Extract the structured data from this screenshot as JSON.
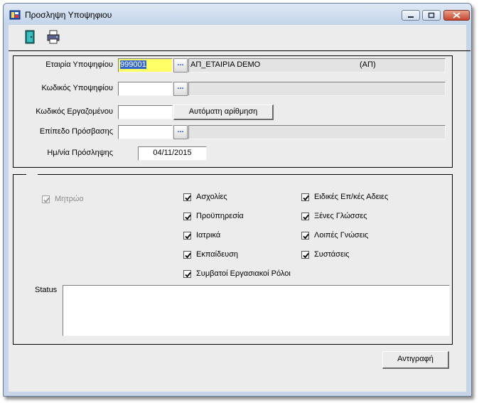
{
  "window": {
    "title": "Προσληψη Υποψηφιου",
    "controls": [
      "minimize-icon",
      "maximize-icon",
      "close-icon"
    ]
  },
  "toolbar": {
    "buttons": [
      {
        "name": "exit-door-icon"
      },
      {
        "name": "printer-icon"
      }
    ]
  },
  "form": {
    "company": {
      "label": "Εταιρία Υποψηφίου",
      "value": "999001",
      "lookup": "...",
      "description": "ΑΠ_ΕΤΑΙΡΙΑ DEMO",
      "code_suffix": "(ΑΠ)"
    },
    "candidate_code": {
      "label": "Κωδικός Υποψηφίου",
      "value": "",
      "lookup": "...",
      "description": ""
    },
    "employee_code": {
      "label": "Κωδικός Εργαζομένου",
      "value": "",
      "auto_button": "Αυτόματη αρίθμηση"
    },
    "access_level": {
      "label": "Επίπεδο Πρόσβασης",
      "value": "",
      "lookup": "...",
      "description": ""
    },
    "hire_date": {
      "label": "Ημ/νία Πρόσληψης",
      "value": "04/11/2015"
    }
  },
  "options": {
    "registry": {
      "label": "Μητρώο",
      "checked": true,
      "disabled": true
    },
    "column1": [
      {
        "label": "Ασχολίες",
        "checked": true
      },
      {
        "label": "Προϋπηρεσία",
        "checked": true
      },
      {
        "label": "Ιατρικά",
        "checked": true
      },
      {
        "label": "Εκπαίδευση",
        "checked": true
      },
      {
        "label": "Συμβατοί Εργασιακοί Ρόλοι",
        "checked": true
      }
    ],
    "column2": [
      {
        "label": "Ειδικές Επ/κές Αδειες",
        "checked": true
      },
      {
        "label": "Ξένες Γλώσσες",
        "checked": true
      },
      {
        "label": "Λοιπές Γνώσεις",
        "checked": true
      },
      {
        "label": "Συστάσεις",
        "checked": true
      }
    ]
  },
  "status": {
    "label": "Status",
    "value": ""
  },
  "copy_button": "Αντιγραφή",
  "colors": {
    "selection": "#3366cc",
    "field_highlight": "#ffff66",
    "lookup_dots": "#1d4fd8"
  }
}
